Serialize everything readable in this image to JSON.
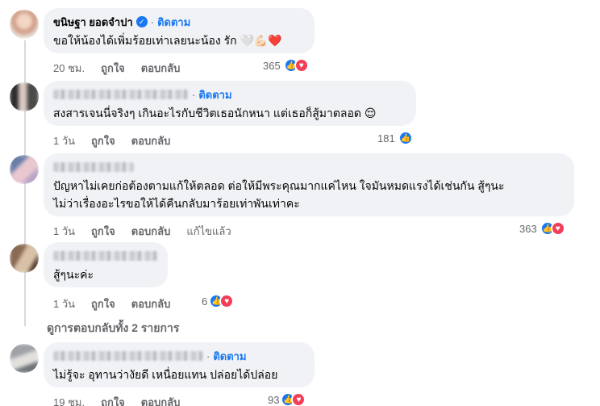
{
  "comments": [
    {
      "name": "ขนิษฐา ยอดจำปา",
      "follow": "ติดตาม",
      "text": "ขอให้น้องได้เพิ่มร้อยเท่าเลยนะน้อง รัก 🤍💪🏻❤️",
      "time": "20 ชม.",
      "like": "ถูกใจ",
      "reply": "ตอบกลับ",
      "reactions": "365"
    },
    {
      "follow": "ติดตาม",
      "text": "สงสารเจนนี่จริงๆ เกินอะไรกับชีวิตเธอนักหนา แต่เธอก็สู้มาตลอด 😌",
      "time": "1 วัน",
      "like": "ถูกใจ",
      "reply": "ตอบกลับ",
      "reactions": "181"
    },
    {
      "text_line1": "ปัญหาไม่เคยก่อต้องตามแก้ให้ตลอด ต่อให้มีพระคุณมากแค่ไหน ใจมันหมดแรงได้เช่นกัน สู้ๆนะ",
      "text_line2": "ไม่ว่าเรื่องอะไรขอให้ได้คืนกลับมาร้อยเท่าพันเท่าคะ",
      "time": "1 วัน",
      "like": "ถูกใจ",
      "reply": "ตอบกลับ",
      "edited": "แก้ไขแล้ว",
      "reactions": "363"
    },
    {
      "text": "สู้ๆนะค่ะ",
      "time": "1 วัน",
      "like": "ถูกใจ",
      "reply": "ตอบกลับ",
      "reactions": "6"
    },
    {
      "follow": "ติดตาม",
      "text": "ไม่รู้จะ อุทานว่างัยดี เหนื่อยแทน ปล่อยได้ปล่อย",
      "time": "19 ชม.",
      "like": "ถูกใจ",
      "reply": "ตอบกลับ",
      "reactions": "93"
    }
  ],
  "see_replies": "ดูการตอบกลับทั้ง 2 รายการ",
  "colors": {
    "accent": "#1877f2",
    "love": "#f33e58",
    "bubble": "#f0f2f5",
    "muted": "#65676b"
  }
}
